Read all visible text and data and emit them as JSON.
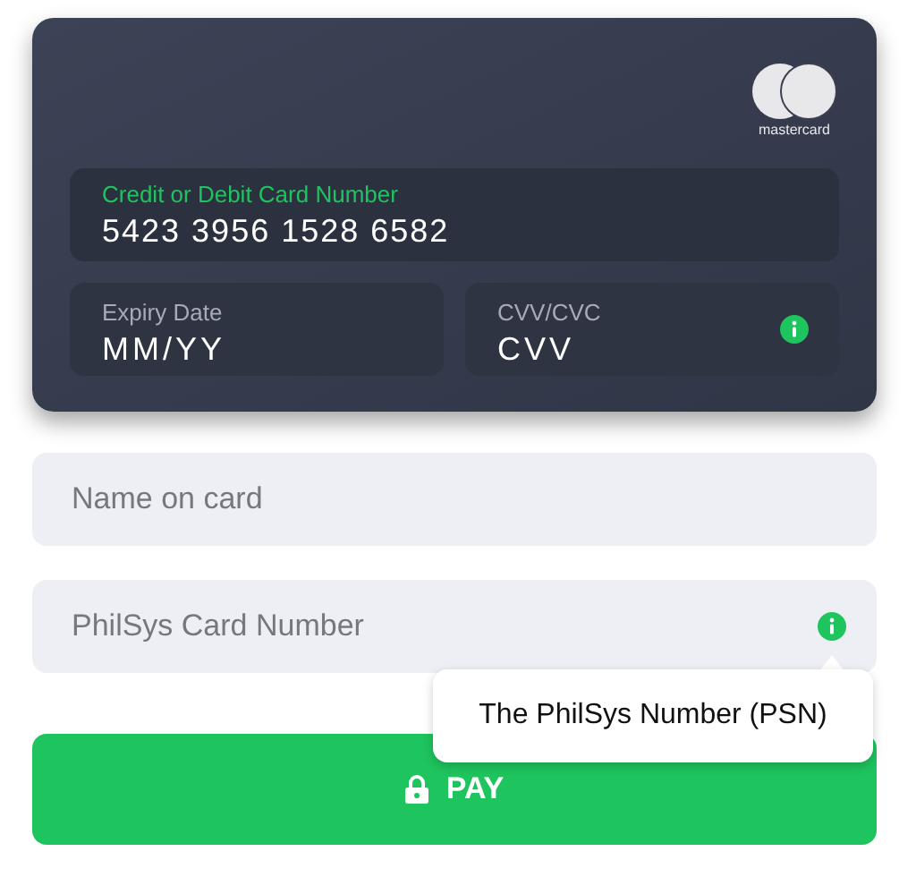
{
  "card": {
    "brand": "mastercard",
    "number": {
      "label": "Credit or Debit Card Number",
      "value": "5423 3956 1528 6582",
      "focused": true
    },
    "expiry": {
      "label": "Expiry Date",
      "placeholder": "MM/YY"
    },
    "cvv": {
      "label": "CVV/CVC",
      "placeholder": "CVV"
    }
  },
  "name_field": {
    "placeholder": "Name on card"
  },
  "philsys_field": {
    "placeholder": "PhilSys Card Number"
  },
  "tooltip": {
    "text": "The PhilSys Number (PSN)"
  },
  "pay_button": {
    "label": "PAY"
  }
}
